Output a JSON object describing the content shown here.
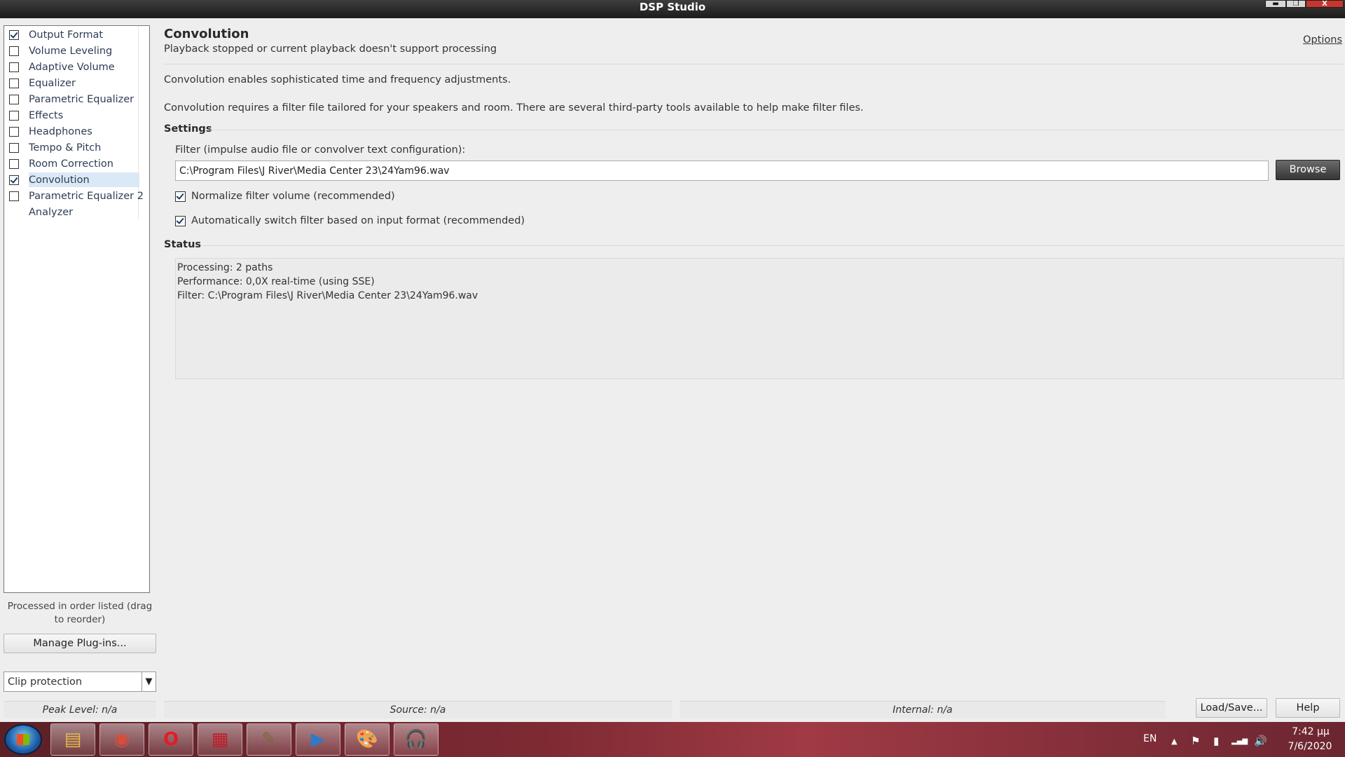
{
  "window": {
    "title": "DSP Studio",
    "minimize_glyph": "▬",
    "maximize_glyph": "❐",
    "close_glyph": "X"
  },
  "plugins": [
    {
      "label": "Output Format",
      "checked": true
    },
    {
      "label": "Volume Leveling",
      "checked": false
    },
    {
      "label": "Adaptive Volume",
      "checked": false
    },
    {
      "label": "Equalizer",
      "checked": false
    },
    {
      "label": "Parametric Equalizer",
      "checked": false
    },
    {
      "label": "Effects",
      "checked": false
    },
    {
      "label": "Headphones",
      "checked": false
    },
    {
      "label": "Tempo & Pitch",
      "checked": false
    },
    {
      "label": "Room Correction",
      "checked": false
    },
    {
      "label": "Convolution",
      "checked": true,
      "selected": true
    },
    {
      "label": "Parametric Equalizer 2",
      "checked": false
    },
    {
      "label": "Analyzer",
      "checked": null
    }
  ],
  "left": {
    "order_note": "Processed in order listed (drag to reorder)",
    "manage_button": "Manage Plug-ins...",
    "clip_select": "Clip protection",
    "clip_arrow": "▼"
  },
  "main": {
    "title": "Convolution",
    "subtitle": "Playback stopped or current playback doesn't support processing",
    "options_link": "Options",
    "description1": "Convolution enables sophisticated time and frequency adjustments.",
    "description2": "Convolution requires a filter file tailored for your speakers and room.  There are several third-party tools available to help make filter files.",
    "settings_heading": "Settings",
    "filter_label": "Filter (impulse audio file or convolver text configuration):",
    "filter_value": "C:\\Program Files\\J River\\Media Center 23\\24Yam96.wav",
    "browse_button": "Browse",
    "normalize_label": "Normalize filter volume (recommended)",
    "auto_switch_label": "Automatically switch filter based on input format (recommended)",
    "status_heading": "Status",
    "status_lines": [
      "Processing: 2 paths",
      "Performance: 0,0X real-time (using SSE)",
      "Filter: C:\\Program Files\\J River\\Media Center 23\\24Yam96.wav"
    ]
  },
  "bottom": {
    "peak_level": "Peak Level: n/a",
    "source": "Source: n/a",
    "internal": "Internal: n/a",
    "load_save_button": "Load/Save...",
    "help_button": "Help"
  },
  "taskbar": {
    "language": "EN",
    "time": "7:42 μμ",
    "date": "7/6/2020",
    "tray_up_glyph": "▲",
    "flag_glyph": "⚑",
    "battery_glyph": "▮",
    "network_glyph": "▂▄▆",
    "volume_glyph": "🔊",
    "apps": [
      {
        "name": "file-explorer-icon",
        "color": "#e9b949",
        "glyph": "▤"
      },
      {
        "name": "chrome-icon",
        "color": "#dd4b39",
        "glyph": "◉"
      },
      {
        "name": "opera-icon",
        "color": "#e21d25",
        "glyph": "O"
      },
      {
        "name": "media-center-icon",
        "color": "#c21d2b",
        "glyph": "▦"
      },
      {
        "name": "notepad-icon",
        "color": "#7a6a3a",
        "glyph": "✎"
      },
      {
        "name": "media-player-icon",
        "color": "#2f79c9",
        "glyph": "▶"
      },
      {
        "name": "paint-icon",
        "color": "#4f9ad8",
        "glyph": "🎨"
      },
      {
        "name": "headphones-app-icon",
        "color": "#d02b33",
        "glyph": "🎧"
      }
    ]
  }
}
